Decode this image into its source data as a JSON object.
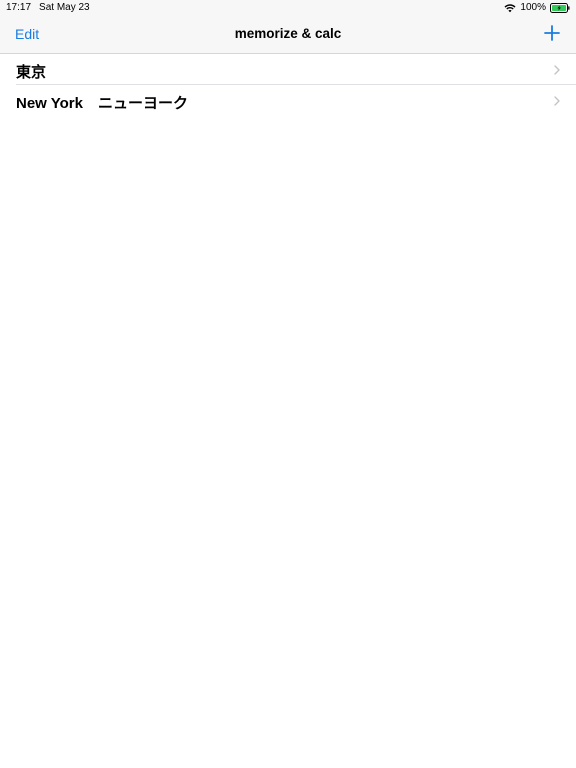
{
  "status_bar": {
    "time": "17:17",
    "date": "Sat May 23",
    "battery": "100%",
    "wifi_icon": "wifi-icon",
    "battery_icon": "battery-charging-icon"
  },
  "nav": {
    "edit_label": "Edit",
    "title": "memorize & calc",
    "add_icon": "plus-icon",
    "accent_color": "#1a7ce0"
  },
  "list": {
    "items": [
      {
        "label": "東京"
      },
      {
        "label": "New York　ニューヨーク"
      }
    ],
    "chevron_icon": "chevron-right-icon"
  }
}
